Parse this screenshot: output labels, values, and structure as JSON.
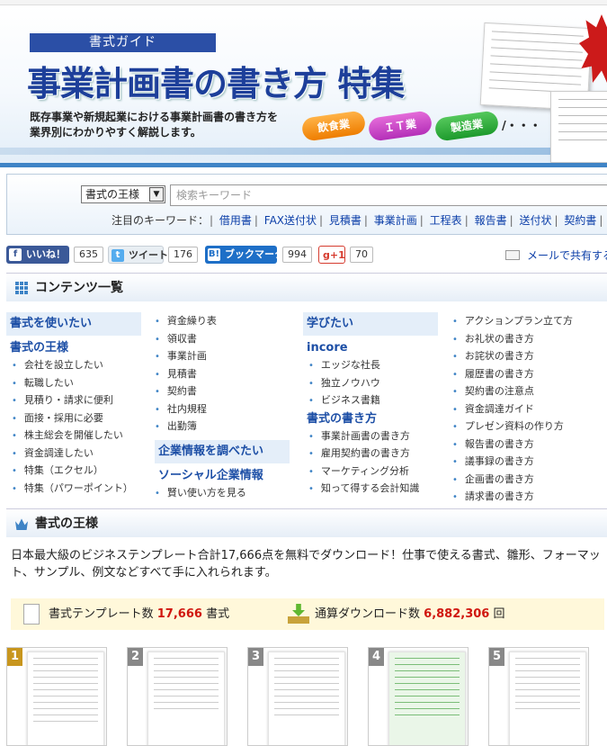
{
  "hero": {
    "tag": "書式ガイド",
    "title": "事業計画書の書き方 特集",
    "desc_line1": "既存事業や新規起業における事業計画書の書き方を",
    "desc_line2": "業界別にわかりやすく解説します。",
    "pills": [
      "飲食業",
      "ＩＴ業",
      "製造業"
    ],
    "etc": "/・・・"
  },
  "search": {
    "select_value": "書式の王様",
    "placeholder": "検索キーワード",
    "keywords_label": "注目のキーワード：",
    "keywords": [
      "借用書",
      "FAX送付状",
      "見積書",
      "事業計画",
      "工程表",
      "報告書",
      "送付状",
      "契約書"
    ]
  },
  "social": {
    "like_label": "いいね！",
    "like_count": "635",
    "tweet_label": "ツイート",
    "tweet_count": "176",
    "bookmark_label": "ブックマーク",
    "bookmark_count": "994",
    "gplus_label": "+1",
    "gplus_count": "70",
    "mail_share": "メールで共有する"
  },
  "contents": {
    "title": "コンテンツ一覧",
    "col1": {
      "heading": "書式を使いたい",
      "sub": "書式の王様",
      "items": [
        "会社を設立したい",
        "転職したい",
        "見積り・請求に便利",
        "面接・採用に必要",
        "株主総会を開催したい",
        "資金調達したい",
        "特集（エクセル）",
        "特集（パワーポイント）"
      ]
    },
    "col2": {
      "items": [
        "資金繰り表",
        "領収書",
        "事業計画",
        "見積書",
        "契約書",
        "社内規程",
        "出勤簿"
      ],
      "heading2": "企業情報を調べたい",
      "sub2": "ソーシャル企業情報",
      "items2": [
        "賢い使い方を見る"
      ]
    },
    "col3": {
      "heading": "学びたい",
      "sub": "incore",
      "items": [
        "エッジな社長",
        "独立ノウハウ",
        "ビジネス書籍"
      ],
      "sub2": "書式の書き方",
      "items2": [
        "事業計画書の書き方",
        "雇用契約書の書き方",
        "マーケティング分析",
        "知って得する会計知識"
      ]
    },
    "col4": {
      "items": [
        "アクションプラン立て方",
        "お礼状の書き方",
        "お詫状の書き方",
        "履歴書の書き方",
        "契約書の注意点",
        "資金調達ガイド",
        "プレゼン資料の作り方",
        "報告書の書き方",
        "議事録の書き方",
        "企画書の書き方",
        "請求書の書き方"
      ]
    }
  },
  "king": {
    "title": "書式の王様",
    "intro": "日本最大級のビジネステンプレート合計17,666点を無料でダウンロード！仕事で使える書式、雛形、フォーマット、サンプル、例文などすべて手に入れられます。",
    "template_label": "書式テンプレート数",
    "template_count": "17,666",
    "template_unit": "書式",
    "download_label": "通算ダウンロード数",
    "download_count": "6,882,306",
    "download_unit": "回"
  },
  "ranking": [
    "1",
    "2",
    "3",
    "4",
    "5"
  ],
  "colors": {
    "accent": "#3f84c6",
    "rank1": "#c8961e",
    "rank_other": "#888888"
  }
}
